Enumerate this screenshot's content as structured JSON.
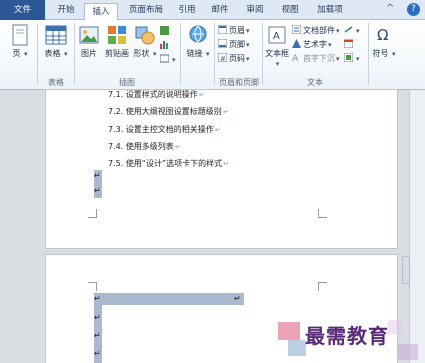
{
  "tabs": [
    {
      "label": "文件"
    },
    {
      "label": "开始"
    },
    {
      "label": "插入"
    },
    {
      "label": "页面布局"
    },
    {
      "label": "引用"
    },
    {
      "label": "邮件"
    },
    {
      "label": "审阅"
    },
    {
      "label": "视图"
    },
    {
      "label": "加载项"
    }
  ],
  "ribbon": {
    "pages_label": "页",
    "table_label": "表格",
    "picture_label": "图片",
    "clipart_label": "剪贴画",
    "shapes_label": "形状",
    "link_label": "链接",
    "header_label": "页眉",
    "footer_label": "页脚",
    "pagenum_label": "页码",
    "textbox_label": "文本框",
    "quickparts_label": "文档部件",
    "wordart_label": "艺术字",
    "dropcap_label": "首字下沉",
    "symbol_label": "符号",
    "groups": {
      "tables": "表格",
      "illustrations": "插图",
      "headerfooter": "页眉和页脚",
      "text": "文本"
    },
    "help_glyph": "?",
    "collapse_glyph": "^"
  },
  "document": {
    "page1_lines": [
      {
        "num": "7.1.",
        "text": "设置样式的说明操作"
      },
      {
        "num": "7.2.",
        "text": "使用大纲视图设置标题级别"
      },
      {
        "num": "7.3.",
        "text": "设置主控文档的相关操作"
      },
      {
        "num": "7.4.",
        "text": "使用多级列表"
      },
      {
        "num": "7.5.",
        "text": "使用“设计”选项卡下的样式"
      }
    ],
    "paragraph_mark": "↵"
  },
  "watermark": {
    "text": "最需教育"
  },
  "colors": {
    "file_tab": "#2b5797",
    "highlight": "#a9b9cf",
    "watermark": "#5a2a7a"
  }
}
